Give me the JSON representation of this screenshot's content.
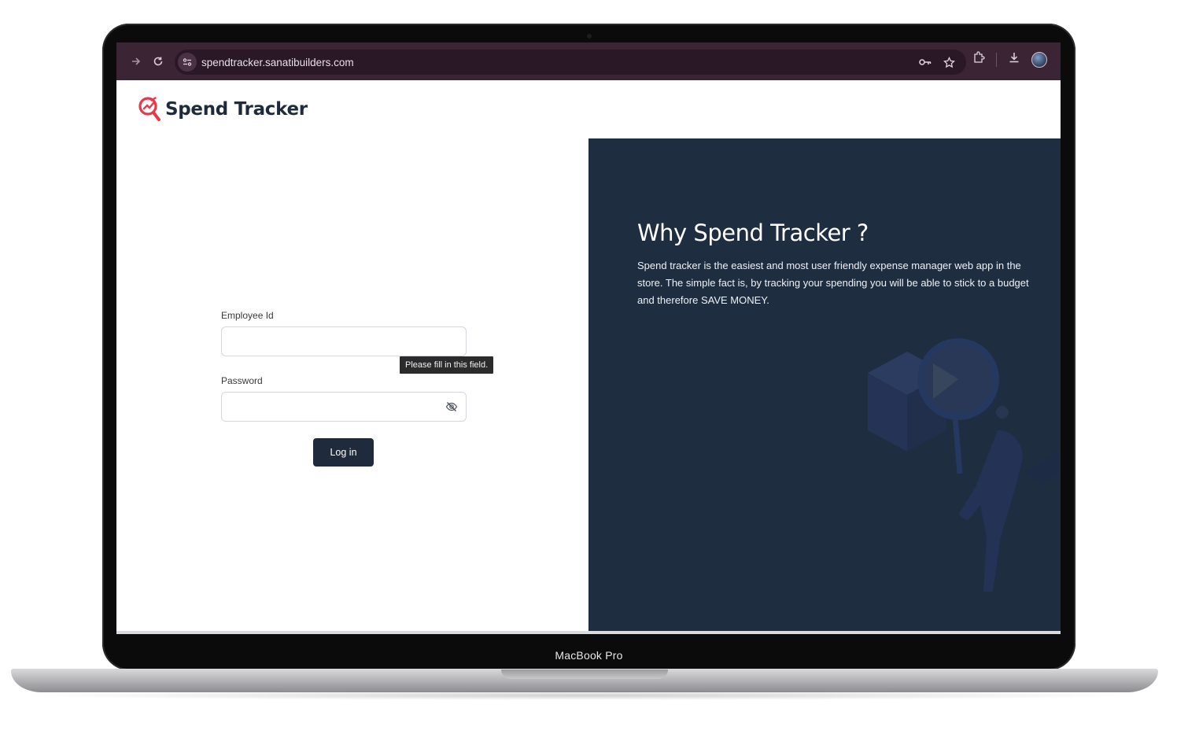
{
  "device": {
    "label": "MacBook Pro"
  },
  "browser": {
    "url": "spendtracker.sanatibuilders.com",
    "icons": [
      "forward-arrow-icon",
      "reload-icon",
      "site-info-icon",
      "password-key-icon",
      "bookmark-star-icon",
      "extensions-icon",
      "download-icon",
      "profile-avatar-icon"
    ]
  },
  "app": {
    "logo_text": "Spend Tracker",
    "logo_accent_color": "#e8394a",
    "primary_color": "#1f2b3d"
  },
  "login_form": {
    "employee_id_label": "Employee Id",
    "employee_id_value": "",
    "password_label": "Password",
    "password_value": "",
    "validation_tooltip": "Please fill in this field.",
    "login_button": "Log in"
  },
  "info_panel": {
    "title": "Why Spend Tracker ?",
    "description": "Spend tracker is the easiest and most user friendly expense manager web app in the store. The simple fact is, by tracking your spending you will be able to stick to a budget and therefore SAVE MONEY."
  }
}
